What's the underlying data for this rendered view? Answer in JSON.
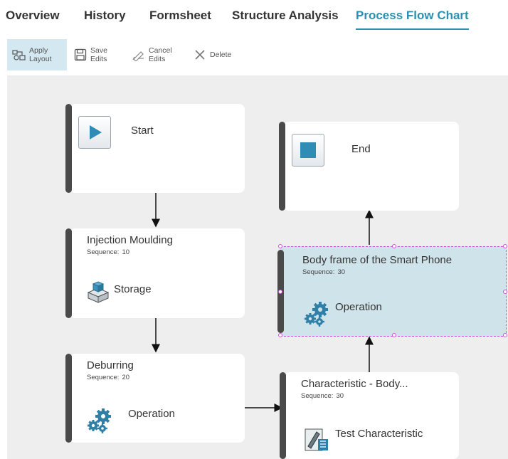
{
  "tabs": [
    {
      "label": "Overview"
    },
    {
      "label": "History"
    },
    {
      "label": "Formsheet"
    },
    {
      "label": "Structure Analysis"
    },
    {
      "label": "Process Flow Chart",
      "active": true
    }
  ],
  "toolbar": {
    "apply_layout": {
      "line1": "Apply",
      "line2": "Layout"
    },
    "save_edits": {
      "line1": "Save",
      "line2": "Edits"
    },
    "cancel_edits": {
      "line1": "Cancel",
      "line2": "Edits"
    },
    "delete": {
      "label": "Delete"
    }
  },
  "flow": {
    "start": {
      "title": "Start",
      "icon": "play-icon"
    },
    "end": {
      "title": "End",
      "icon": "stop-icon"
    },
    "sequence_label": "Sequence:",
    "nodes": [
      {
        "title": "Injection Moulding",
        "sequence": "10",
        "type": "Storage",
        "icon": "storage-icon"
      },
      {
        "title": "Deburring",
        "sequence": "20",
        "type": "Operation",
        "icon": "gears-icon"
      },
      {
        "title": "Characteristic - Body...",
        "sequence": "30",
        "type": "Test Characteristic",
        "icon": "test-characteristic-icon"
      },
      {
        "title": "Body frame of the Smart Phone",
        "sequence": "30",
        "type": "Operation",
        "icon": "gears-icon",
        "selected": true
      }
    ]
  },
  "colors": {
    "accent": "#2a8fb0",
    "canvas": "#eeeeee",
    "node_bar": "#4a4a4a",
    "selected_fill": "#cfe3ea",
    "selection_border": "#d04fd8"
  }
}
